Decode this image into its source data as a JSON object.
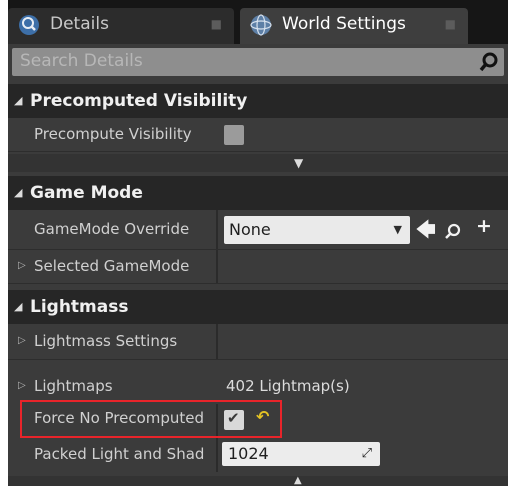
{
  "tabs": [
    {
      "label": "Details",
      "icon": "magnifier-icon",
      "active": false
    },
    {
      "label": "World Settings",
      "icon": "globe-icon",
      "active": true
    }
  ],
  "search": {
    "placeholder": "Search Details",
    "icon": "search-icon"
  },
  "categories": {
    "precomputed_visibility": {
      "title": "Precomputed Visibility",
      "rows": [
        {
          "label": "Precompute Visibility",
          "checked": false
        }
      ]
    },
    "game_mode": {
      "title": "Game Mode",
      "rows": [
        {
          "label": "GameMode Override",
          "value": "None"
        },
        {
          "label": "Selected GameMode"
        }
      ]
    },
    "lightmass": {
      "title": "Lightmass",
      "rows": [
        {
          "label": "Lightmass Settings"
        },
        {
          "label": "Lightmaps",
          "value": "402 Lightmap(s)"
        },
        {
          "label": "Force No Precomputed",
          "checked": true
        },
        {
          "label": "Packed Light and Shad",
          "value": "1024"
        }
      ]
    }
  },
  "colors": {
    "highlight": "#e8242a",
    "reset_icon": "#e3c224",
    "panel": "#3b3b3b",
    "category": "#262626"
  }
}
